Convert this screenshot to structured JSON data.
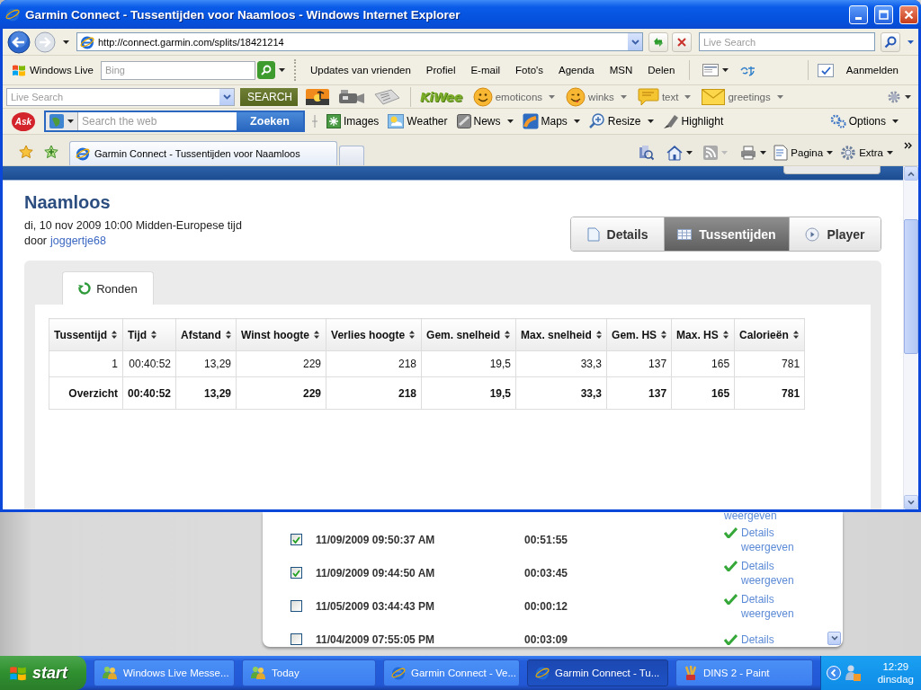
{
  "window": {
    "title": "Garmin Connect - Tussentijden voor Naamloos - Windows Internet Explorer"
  },
  "address_bar": {
    "url": "http://connect.garmin.com/splits/18421214",
    "search_placeholder": "Live Search"
  },
  "windows_live_bar": {
    "brand": "Windows Live",
    "search_placeholder": "Bing",
    "links": [
      "Updates van vrienden",
      "Profiel",
      "E-mail",
      "Foto's",
      "Agenda",
      "MSN",
      "Delen"
    ],
    "sign_in": "Aanmelden"
  },
  "kiwee_bar": {
    "search_placeholder": "Live Search",
    "search_button": "SEARCH",
    "logo": "KiWee",
    "items": [
      "emoticons",
      "winks",
      "text",
      "greetings"
    ]
  },
  "ask_bar": {
    "logo": "Ask",
    "search_placeholder": "Search the web",
    "search_button": "Zoeken",
    "items": [
      "Images",
      "Weather",
      "News",
      "Maps",
      "Resize",
      "Highlight"
    ],
    "options": "Options"
  },
  "tab_bar": {
    "tabs": [
      {
        "label": "Garmin Connect - Tussentijden voor Naamloos",
        "selected": true
      }
    ],
    "commands": [
      "Pagina",
      "Extra"
    ]
  },
  "page": {
    "title": "Naamloos",
    "date": "di, 10 nov 2009 10:00 Midden-Europese tijd",
    "author_prefix": "door",
    "author": "joggertje68",
    "views": [
      {
        "label": "Details",
        "selected": false
      },
      {
        "label": "Tussentijden",
        "selected": true
      },
      {
        "label": "Player",
        "selected": false
      }
    ],
    "subtabs": [
      {
        "label": "Ronden",
        "selected": true
      }
    ],
    "table": {
      "columns": [
        "Tussentijd",
        "Tijd",
        "Afstand",
        "Winst hoogte",
        "Verlies hoogte",
        "Gem. snelheid",
        "Max. snelheid",
        "Gem. HS",
        "Max. HS",
        "Calorieën"
      ],
      "rows": [
        {
          "kind": "lap",
          "cells": [
            "1",
            "00:40:52",
            "13,29",
            "229",
            "218",
            "19,5",
            "33,3",
            "137",
            "165",
            "781"
          ]
        },
        {
          "kind": "summary",
          "cells": [
            "Overzicht",
            "00:40:52",
            "13,29",
            "229",
            "218",
            "19,5",
            "33,3",
            "137",
            "165",
            "781"
          ]
        }
      ]
    }
  },
  "background_window": {
    "cut_link": "weergeven",
    "activities": [
      {
        "checked": true,
        "date": "11/09/2009 09:50:37 AM",
        "duration": "00:51:55",
        "link": "Details weergeven"
      },
      {
        "checked": true,
        "date": "11/09/2009 09:44:50 AM",
        "duration": "00:03:45",
        "link": "Details weergeven"
      },
      {
        "checked": false,
        "date": "11/05/2009 03:44:43 PM",
        "duration": "00:00:12",
        "link": "Details weergeven"
      },
      {
        "checked": false,
        "date": "11/04/2009 07:55:05 PM",
        "duration": "00:03:09",
        "link": "Details"
      }
    ]
  },
  "taskbar": {
    "start": "start",
    "tasks": [
      {
        "label": "Windows Live Messe...",
        "selected": false
      },
      {
        "label": "Today",
        "selected": false
      },
      {
        "label": "Garmin Connect - Ve...",
        "selected": false
      },
      {
        "label": "Garmin Connect - Tu...",
        "selected": true
      },
      {
        "label": "DINS 2 - Paint",
        "selected": false
      }
    ],
    "clock": "12:29",
    "day": "dinsdag"
  }
}
